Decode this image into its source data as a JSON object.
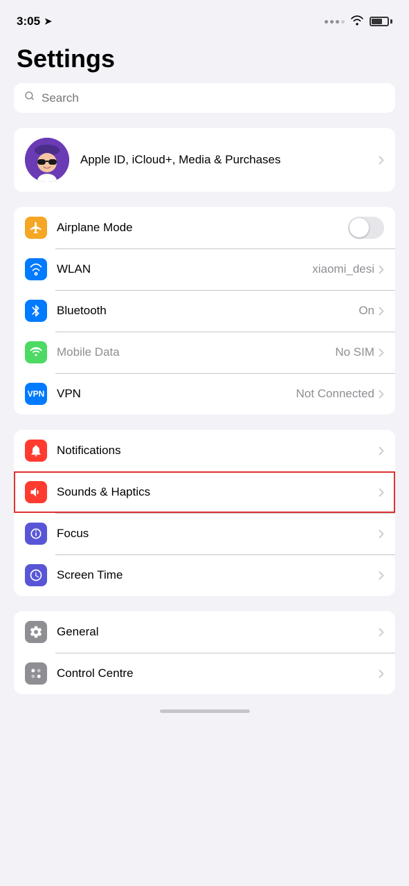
{
  "statusBar": {
    "time": "3:05",
    "battery": 70
  },
  "page": {
    "title": "Settings"
  },
  "search": {
    "placeholder": "Search"
  },
  "appleId": {
    "label": "Apple ID, iCloud+, Media & Purchases"
  },
  "networkGroup": {
    "items": [
      {
        "id": "airplane",
        "label": "Airplane Mode",
        "value": "",
        "type": "toggle",
        "toggleOn": false,
        "iconBg": "#f5a623",
        "iconColor": "#fff"
      },
      {
        "id": "wlan",
        "label": "WLAN",
        "value": "xiaomi_desi",
        "type": "chevron",
        "iconBg": "#007aff",
        "iconColor": "#fff"
      },
      {
        "id": "bluetooth",
        "label": "Bluetooth",
        "value": "On",
        "type": "chevron",
        "iconBg": "#007aff",
        "iconColor": "#fff"
      },
      {
        "id": "mobiledata",
        "label": "Mobile Data",
        "value": "No SIM",
        "type": "chevron",
        "iconBg": "#4cd964",
        "iconColor": "#fff",
        "labelMuted": true
      },
      {
        "id": "vpn",
        "label": "VPN",
        "value": "Not Connected",
        "type": "chevron",
        "iconBg": "#007aff",
        "iconColor": "#fff"
      }
    ]
  },
  "settingsGroup2": {
    "items": [
      {
        "id": "notifications",
        "label": "Notifications",
        "type": "chevron",
        "iconBg": "#ff3b30",
        "iconColor": "#fff",
        "highlighted": false
      },
      {
        "id": "sounds",
        "label": "Sounds & Haptics",
        "type": "chevron",
        "iconBg": "#ff3b30",
        "iconColor": "#fff",
        "highlighted": true
      },
      {
        "id": "focus",
        "label": "Focus",
        "type": "chevron",
        "iconBg": "#5856d6",
        "iconColor": "#fff",
        "highlighted": false
      },
      {
        "id": "screentime",
        "label": "Screen Time",
        "type": "chevron",
        "iconBg": "#5856d6",
        "iconColor": "#fff",
        "highlighted": false
      }
    ]
  },
  "settingsGroup3": {
    "items": [
      {
        "id": "general",
        "label": "General",
        "type": "chevron",
        "iconBg": "#8e8e93",
        "iconColor": "#fff",
        "highlighted": false
      },
      {
        "id": "controlcentre",
        "label": "Control Centre",
        "type": "chevron",
        "iconBg": "#8e8e93",
        "iconColor": "#fff",
        "highlighted": false
      }
    ]
  }
}
